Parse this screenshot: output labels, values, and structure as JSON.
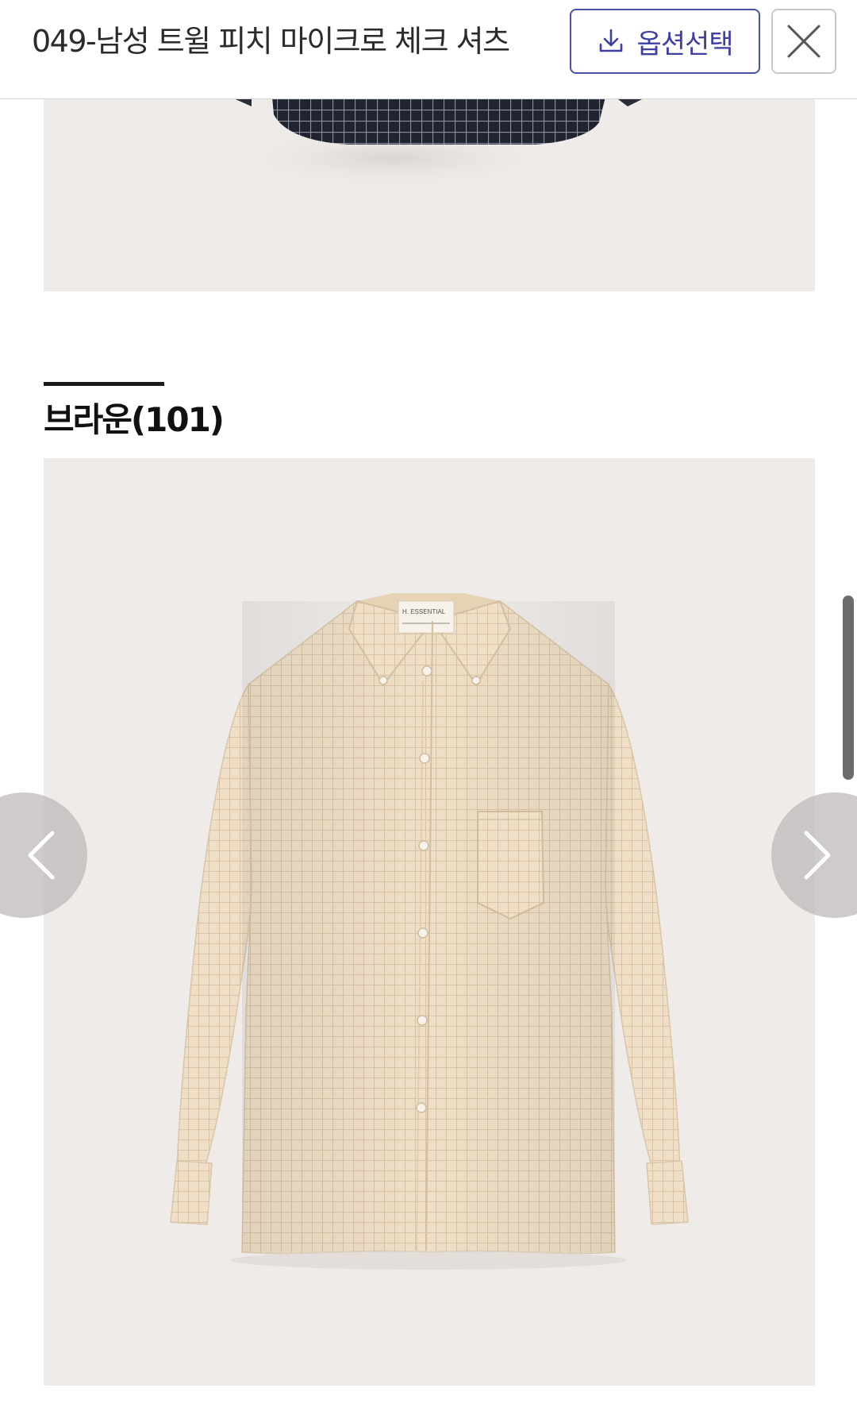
{
  "header": {
    "product_title": "049-남성 트윌 피치 마이크로 체크 셔츠",
    "option_button_label": "옵션선택",
    "download_icon": "download-icon",
    "close_icon": "close-icon"
  },
  "section": {
    "color_title": "브라운(101)"
  },
  "product_image": {
    "shirt_tag_brand": "H.ESSENTIAL",
    "description": "beige micro check button-down shirt"
  },
  "carousel": {
    "prev_icon": "chevron-left-icon",
    "next_icon": "chevron-right-icon"
  },
  "colors": {
    "accent": "#3d3fa3",
    "image_background": "#eeebe9",
    "shirt": "#efdfc7"
  }
}
